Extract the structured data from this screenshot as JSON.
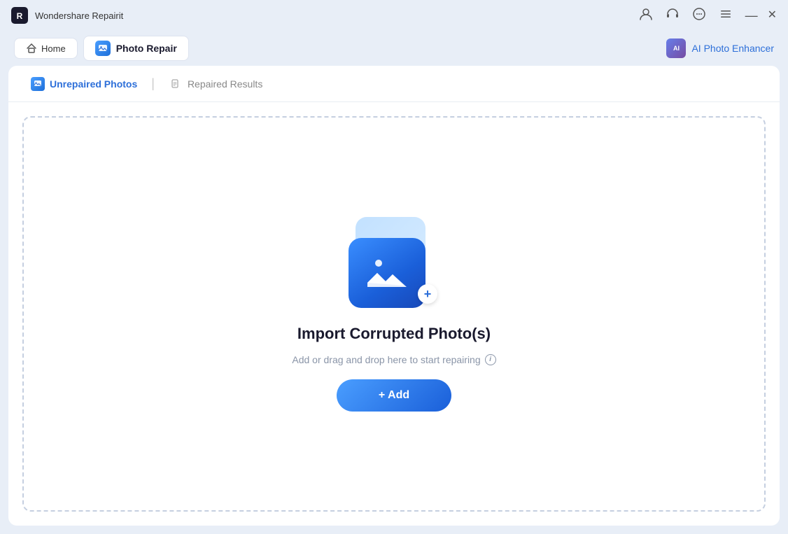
{
  "titleBar": {
    "appName": "Wondershare Repairit"
  },
  "navBar": {
    "homeLabel": "Home",
    "activeTabLabel": "Photo Repair",
    "enhancerLabel": "AI Photo Enhancer"
  },
  "tabs": {
    "unrepairedLabel": "Unrepaired Photos",
    "repairedLabel": "Repaired Results"
  },
  "dropZone": {
    "title": "Import Corrupted Photo(s)",
    "subtitle": "Add or drag and drop here to start repairing",
    "addButtonLabel": "+ Add"
  },
  "icons": {
    "home": "⌂",
    "minimize": "—",
    "close": "✕",
    "menu": "☰",
    "profile": "👤",
    "headset": "🎧",
    "chat": "💬",
    "plus": "+",
    "info": "i"
  }
}
